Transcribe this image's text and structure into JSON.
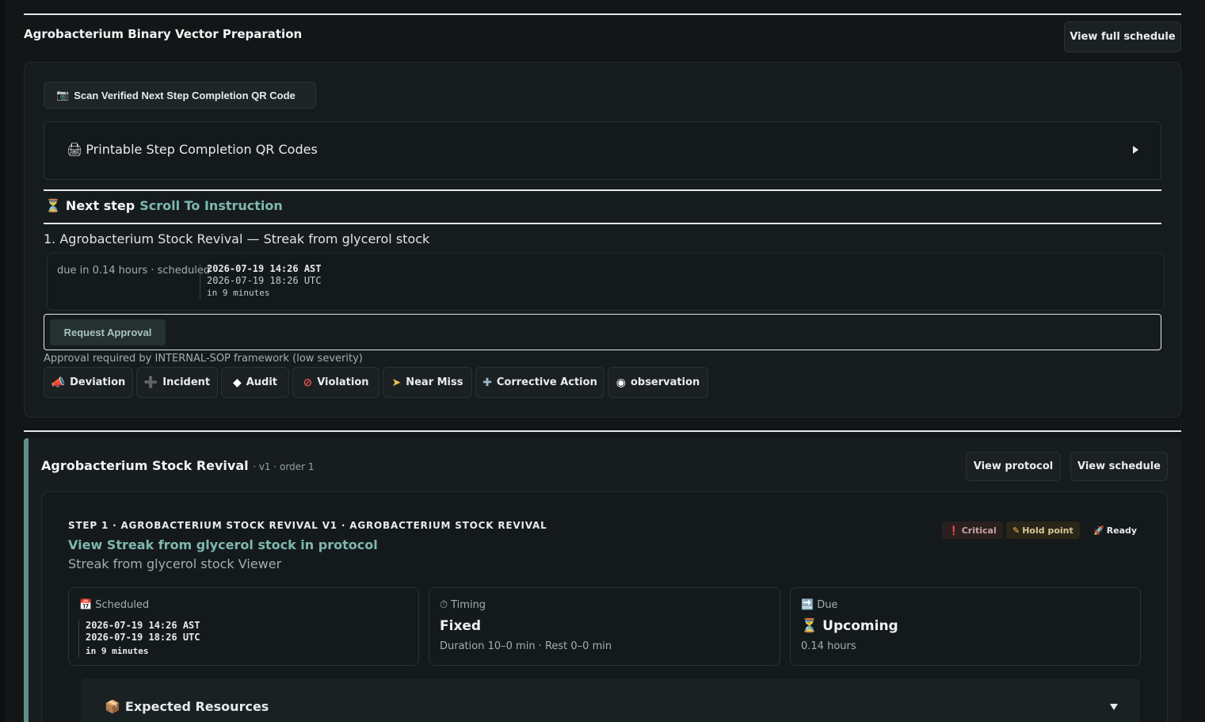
{
  "colors": {
    "background": "#121617",
    "accent": "#7fb7b0",
    "card": "#161c1d"
  },
  "schedule_section": {
    "title": "Agrobacterium Binary Vector Preparation",
    "view_full_schedule": "View full schedule",
    "scan_qr_label": "Scan Verified Next Step Completion QR Code",
    "scan_qr_icon": "camera-icon",
    "printable_qr_label": "Printable Step Completion QR Codes",
    "printable_qr_icon": "printer-icon",
    "next_step_label": "Next step",
    "scroll_link": "Scroll To Instruction",
    "step_line": "1. Agrobacterium Stock Revival — Streak from glycerol stock",
    "due_text": "due in 0.14 hours · scheduled",
    "time_local": "2026-07-19 14:26 AST",
    "time_utc": "2026-07-19 18:26 UTC",
    "time_relative": "in 9 minutes",
    "request_approval": "Request Approval",
    "approval_note": "Approval required by INTERNAL-SOP framework (low severity)",
    "report_buttons": [
      {
        "label": "Deviation",
        "icon": "megaphone-icon"
      },
      {
        "label": "Incident",
        "icon": "plus-icon"
      },
      {
        "label": "Audit",
        "icon": "diamond-icon"
      },
      {
        "label": "Violation",
        "icon": "prohibited-icon"
      },
      {
        "label": "Near Miss",
        "icon": "flag-icon"
      },
      {
        "label": "Corrective Action",
        "icon": "signpost-icon"
      },
      {
        "label": "observation",
        "icon": "eye-icon"
      }
    ]
  },
  "protocol_section": {
    "title": "Agrobacterium Stock Revival",
    "meta": "· v1 · order 1",
    "view_protocol": "View protocol",
    "view_schedule": "View schedule",
    "step_heading": "STEP 1 · AGROBACTERIUM STOCK REVIVAL V1 · AGROBACTERIUM STOCK REVIVAL",
    "view_link": "View Streak from glycerol stock in protocol",
    "viewer_label": "Streak from glycerol stock Viewer",
    "badges": {
      "critical": "Critical",
      "hold_point": "Hold point",
      "ready": "Ready"
    },
    "scheduled": {
      "label": "Scheduled",
      "time_local": "2026-07-19 14:26 AST",
      "time_utc": "2026-07-19 18:26 UTC",
      "time_relative": "in 9 minutes"
    },
    "timing": {
      "label": "Timing",
      "value": "Fixed",
      "detail": "Duration 10–0 min · Rest 0–0 min"
    },
    "due": {
      "label": "Due",
      "value": "Upcoming",
      "detail": "0.14 hours"
    },
    "expected_resources": "Expected Resources"
  }
}
